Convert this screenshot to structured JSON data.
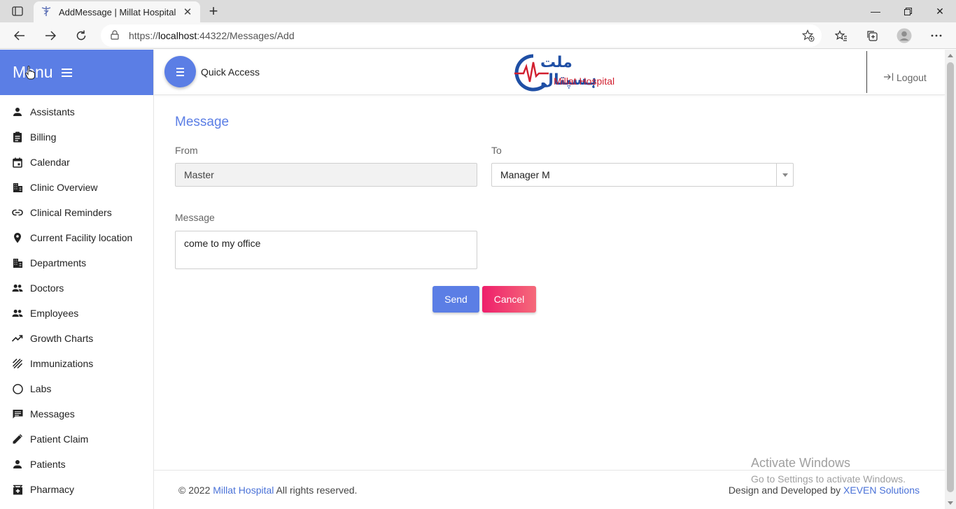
{
  "browser": {
    "tab_title": "AddMessage | Millat Hospital",
    "url_base": "https://",
    "url_host": "localhost",
    "url_rest": ":44322/Messages/Add"
  },
  "sidebar": {
    "title": "Menu",
    "items": [
      {
        "label": "Assistants",
        "icon": "person-icon"
      },
      {
        "label": "Billing",
        "icon": "clipboard-icon"
      },
      {
        "label": "Calendar",
        "icon": "calendar-icon"
      },
      {
        "label": "Clinic Overview",
        "icon": "building-icon"
      },
      {
        "label": "Clinical Reminders",
        "icon": "link-icon"
      },
      {
        "label": "Current Facility location",
        "icon": "location-pin-icon"
      },
      {
        "label": "Departments",
        "icon": "building-icon"
      },
      {
        "label": "Doctors",
        "icon": "people-icon"
      },
      {
        "label": "Employees",
        "icon": "people-icon"
      },
      {
        "label": "Growth Charts",
        "icon": "trending-up-icon"
      },
      {
        "label": "Immunizations",
        "icon": "texture-icon"
      },
      {
        "label": "Labs",
        "icon": "circle-icon"
      },
      {
        "label": "Messages",
        "icon": "message-icon"
      },
      {
        "label": "Patient Claim",
        "icon": "pencil-icon"
      },
      {
        "label": "Patients",
        "icon": "person-icon"
      },
      {
        "label": "Pharmacy",
        "icon": "pharmacy-icon"
      }
    ]
  },
  "header": {
    "quick_access": "Quick Access",
    "logo_urdu": "ملت ہسپتال",
    "logo_en": "Millat Hospital",
    "logout": "Logout"
  },
  "form": {
    "title": "Message",
    "from_label": "From",
    "from_value": "Master",
    "to_label": "To",
    "to_value": "Manager M",
    "message_label": "Message",
    "message_value": "come to my office",
    "send": "Send",
    "cancel": "Cancel"
  },
  "footer": {
    "copy_prefix": "© 2022",
    "copy_link": "Millat Hospital",
    "copy_suffix": "All rights reserved.",
    "credit_prefix": "Design and Developed by",
    "credit_link": "XEVEN Solutions"
  },
  "watermark": {
    "line1": "Activate Windows",
    "line2": "Go to Settings to activate Windows."
  },
  "colors": {
    "primary": "#5b7ee5",
    "cancel": "#ee1f6b",
    "logo_red": "#d11f2f",
    "logo_blue": "#1f4fa5"
  }
}
